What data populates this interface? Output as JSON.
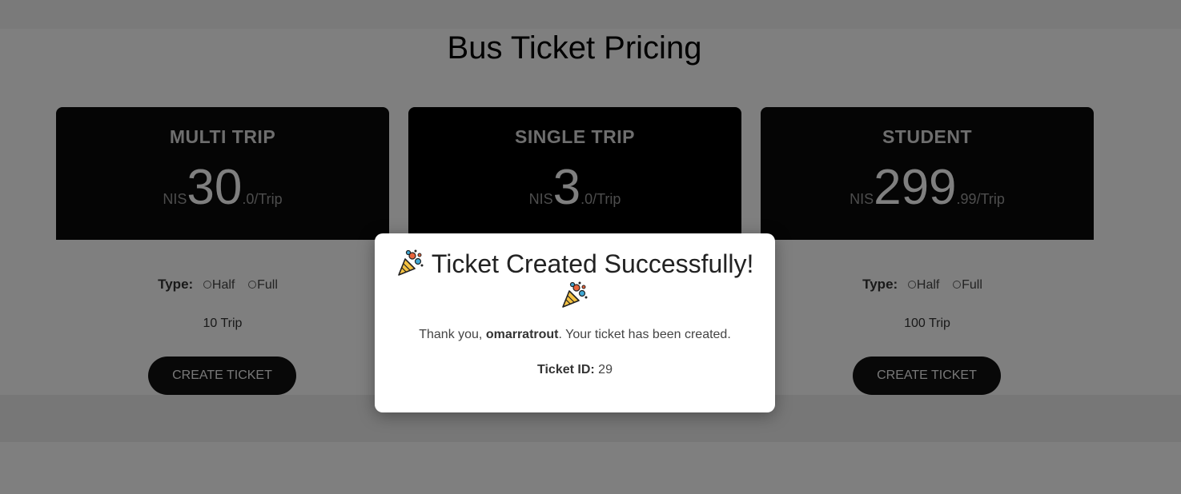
{
  "page": {
    "title": "Bus Ticket Pricing"
  },
  "cards": [
    {
      "title": "MULTI TRIP",
      "currency": "NIS",
      "amount": "30",
      "suffix": ".0/Trip",
      "type_label": "Type:",
      "options": [
        "Half",
        "Full"
      ],
      "trips": "10 Trip",
      "button": "CREATE TICKET"
    },
    {
      "title": "SINGLE TRIP",
      "currency": "NIS",
      "amount": "3",
      "suffix": ".0/Trip"
    },
    {
      "title": "STUDENT",
      "currency": "NIS",
      "amount": "299",
      "suffix": ".99/Trip",
      "type_label": "Type:",
      "options": [
        "Half",
        "Full"
      ],
      "trips": "100 Trip",
      "button": "CREATE TICKET"
    }
  ],
  "modal": {
    "heading": "Ticket Created Successfully!",
    "icon": "party-popper-icon",
    "message_prefix": "Thank you, ",
    "username": "omarratrout",
    "message_suffix": ". Your ticket has been created.",
    "id_label": "Ticket ID:",
    "id_value": " 29"
  },
  "colors": {
    "card_header": "#0a0a0a",
    "button": "#111111",
    "overlay": "rgba(0,0,0,0.5)"
  }
}
